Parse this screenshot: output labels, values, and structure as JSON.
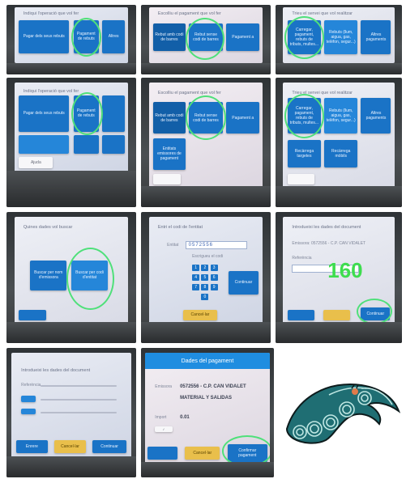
{
  "steps": {
    "p1": {
      "prompt": "Indiqui l'operació que vol fer",
      "tile_pay": "Pagar dels seus rebuts",
      "tile_payment": "Pagament de rebuts",
      "tile_other": "Altres"
    },
    "p2": {
      "prompt": "Escolliu el pagament que vol fer",
      "tile_barcode": "Rebut amb codi de barres",
      "tile_nobarcode": "Rebut sense codi de barres",
      "tile_other": "Pagament a"
    },
    "p3": {
      "prompt": "Trieu el servei que vol realitzar",
      "tile_fines": "Carregar, pagament, rebuts de tributs, multes...",
      "tile_bills": "Rebuts (llum, aigua, gas, telèfon, segur...)",
      "tile_other": "Altres pagaments"
    },
    "p4": {
      "prompt": "Indiqui l'operació que vol fer",
      "tile_pay": "Pagar dels seus rebuts",
      "tile_payment": "Pagament de rebuts",
      "footer": "Ajuda"
    },
    "p5": {
      "prompt": "Escolliu el pagament que vol fer",
      "tile_barcode": "Rebut amb codi de barres",
      "tile_nobarcode": "Rebut sense codi de barres",
      "tile_extra": "Entitats emissores de pagament",
      "tile_other": "Pagament a"
    },
    "p6": {
      "prompt": "Trieu el servei que vol realitzar",
      "tile_fines": "Carregar, pagament, rebuts de tributs, multes...",
      "tile_bills": "Rebuts (llum, aigua, gas, telèfon, segur...)",
      "tile_more": "Altres pagaments",
      "tile_cards": "Recàrrega targetes",
      "tile_mobile": "Recàrrega mòbils"
    },
    "p7": {
      "prompt": "Quines dades vol buscar",
      "tile_left": "Buscar per nom d'emissora",
      "tile_right": "Buscar per codi d'entitat"
    },
    "p8": {
      "prompt": "Entri el codi de l'entitat",
      "code_label": "Entitat",
      "code_value": "0572556",
      "hint": "Escrigueu el codi",
      "keys": [
        "1",
        "2",
        "3",
        "4",
        "5",
        "6",
        "7",
        "8",
        "9",
        "0"
      ],
      "ok": "Continuar",
      "cancel": "Cancel·lar"
    },
    "p9": {
      "prompt": "Introdueixi les dades del document",
      "field1": "Emissora: 0572556 - C.P. CAN VIDALET",
      "field2": "Referència",
      "number": "160",
      "next": "Continuar"
    },
    "p10": {
      "prompt": "Introdueixi les dades del document",
      "field_label": "Referència",
      "left": "Enrere",
      "mid": "Cancel·lar",
      "right": "Continuar"
    },
    "p11": {
      "header": "Dades del pagament",
      "entity_label": "Emissora",
      "entity_value": "0572556 - C.P. CAN VIDALET",
      "concept_value": "MATERIAL Y SALIDAS",
      "amount_label": "Import",
      "amount_value": "0.01",
      "cancel": "Cancel·lar",
      "confirm": "Confirmar pagament"
    }
  },
  "colors": {
    "tile": "#1a73c6",
    "highlight": "#4fe07a",
    "header": "#1f8de0",
    "accent": "#e9bf4b"
  }
}
